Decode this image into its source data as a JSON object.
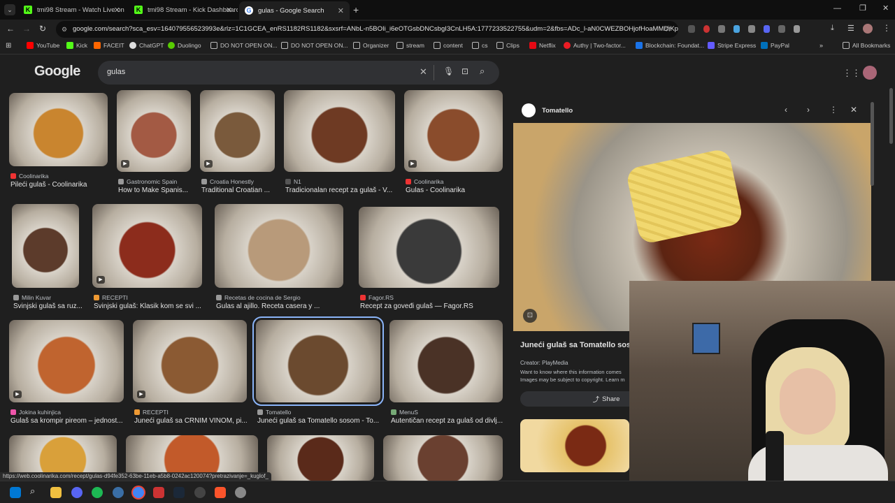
{
  "tabs": [
    {
      "title": "tmi98 Stream - Watch Live on K",
      "icon": "kick-icon"
    },
    {
      "title": "tmi98 Stream - Kick Dashboard",
      "icon": "kick-icon"
    },
    {
      "title": "gulas - Google Search",
      "icon": "google-icon"
    }
  ],
  "address": "google.com/search?sca_esv=164079556523993e&rlz=1C1GCEA_enRS1182RS1182&sxsrf=ANbL-n5BOIi_i6eOTGsbDNCsbgI3CnLH5A:1777233522755&udm=2&fbs=ADc_l-aN0CWEZBOHjofHoaMMDiKpa...",
  "bookmarks": [
    "YouTube",
    "Kick",
    "FACEIT",
    "ChatGPT",
    "Duolingo",
    "DO NOT OPEN ON...",
    "DO NOT OPEN ON...",
    "Organizer",
    "stream",
    "content",
    "cs",
    "Clips",
    "Netflix",
    "Authy | Two-factor...",
    "Blockchain: Foundat...",
    "Stripe Express",
    "PayPal",
    "All Bookmarks"
  ],
  "search": {
    "logo": "Google",
    "query": "gulas"
  },
  "results": [
    {
      "source": "Coolinarika",
      "title": "Pileći gulaš - Coolinarika",
      "c": "#c9852f",
      "s": "#e33"
    },
    {
      "source": "Gastronomic Spain",
      "title": "How to Make Spanis...",
      "c": "#a35a44",
      "s": "#999"
    },
    {
      "source": "Croatia Honestly",
      "title": "Traditional Croatian ...",
      "c": "#7a5a3c",
      "s": "#999"
    },
    {
      "source": "N1",
      "title": "Tradicionalan recept za gulaš - V...",
      "c": "#6e3a23",
      "s": "#555"
    },
    {
      "source": "Coolinarika",
      "title": "Gulas - Coolinarika",
      "c": "#8a4c2c",
      "s": "#e33"
    },
    {
      "source": "Milin Kuvar",
      "title": "Svinjski gulaš sa ruz...",
      "c": "#5c3b2b",
      "s": "#999"
    },
    {
      "source": "RECEPTI",
      "title": "Svinjski gulaš: Klasik kom se svi ...",
      "c": "#8c2c1c",
      "s": "#e93"
    },
    {
      "source": "Recetas de cocina de Sergio",
      "title": "Gulas al ajillo. Receta casera y ...",
      "c": "#b89a7a",
      "s": "#999"
    },
    {
      "source": "Fagor.RS",
      "title": "Recept za goveđi gulaš — Fagor.RS",
      "c": "#3a3a3a",
      "s": "#e33"
    },
    {
      "source": "Jokina kuhinjica",
      "title": "Gulaš sa krompir pireom – jednost...",
      "c": "#c0642f",
      "s": "#e5a"
    },
    {
      "source": "RECEPTI",
      "title": "Juneći gulaš sa CRNIM VINOM, pi...",
      "c": "#8b5a33",
      "s": "#e93"
    },
    {
      "source": "Tomatello",
      "title": "Juneći gulaš sa Tomatello sosom - To...",
      "c": "#6b4a2f",
      "s": "#999"
    },
    {
      "source": "MenuS",
      "title": "Autentičan recept za gulaš od divlj...",
      "c": "#4a3226",
      "s": "#7a7"
    },
    {
      "source": "",
      "title": "",
      "c": "#d9a03a",
      "s": "#999"
    },
    {
      "source": "",
      "title": "",
      "c": "#c25a2a",
      "s": "#999"
    },
    {
      "source": "",
      "title": "",
      "c": "#5a2a1a",
      "s": "#999"
    },
    {
      "source": "",
      "title": "",
      "c": "#6a4030",
      "s": "#999"
    }
  ],
  "panel": {
    "site": "Tomatello",
    "title": "Juneći gulaš sa Tomatello sos",
    "creator": "Creator: PlayMedia",
    "notice1": "Want to know where this information comes",
    "notice2": "Images may be subject to copyright. Learn m",
    "share": "Share"
  },
  "status_url": "https://web.coolinarika.com/recept/gulas-d94fe352-63be-11eb-a5b8-0242ac120074?pretrazivanje=_kuglof_"
}
